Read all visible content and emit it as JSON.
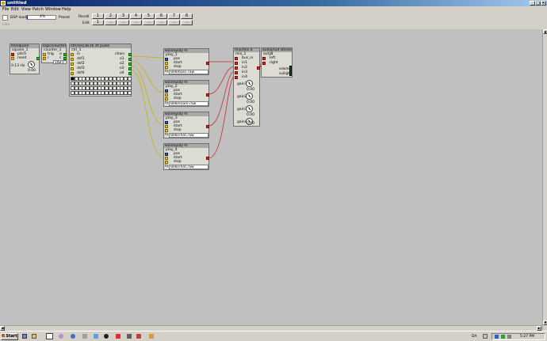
{
  "window": {
    "title": "untitled"
  },
  "menu": [
    "File",
    "Edit",
    "View",
    "Patch",
    "Window",
    "Help"
  ],
  "toolbar": {
    "dsp_label": "DSP load",
    "dsp_value": "4%",
    "dsp_fraction": 0.04,
    "preset_label": "Preset",
    "recall_label": "Recall",
    "edit_label": "Edit",
    "preset_numbers": [
      "1",
      "2",
      "3",
      "4",
      "5",
      "6",
      "7",
      "8"
    ],
    "preset_edit": [
      "1",
      "...",
      "...",
      "...",
      "...",
      "...",
      "...",
      "..."
    ],
    "live_label": "Live"
  },
  "objects": {
    "square": {
      "header": "lfo/square",
      "name": "square_1",
      "pitch": "pitch",
      "reset": "reset",
      "freq": "0.13 Hz",
      "value": "0.00"
    },
    "counter": {
      "header": "logic/counter",
      "name": "counter_1",
      "trig": "trig",
      "r": "r",
      "o": "o",
      "c": "c",
      "val1": "16",
      "val2": "0"
    },
    "seq": {
      "header": "ctrl/seq 8x16 4t pulse",
      "name": "ctrl_1",
      "in": "in",
      "dsf1": "dsf1",
      "dsf2": "dsf2",
      "dsf3": "dsf3",
      "dsf4": "dsf4",
      "chain": "chain",
      "o1": "o1",
      "o2": "o2",
      "o3": "o3",
      "o4": "o4"
    },
    "play1": {
      "header": "wave/play fn",
      "name": "play_1",
      "pos": "pos",
      "start": "start",
      "stop": "stop",
      "file": "808/bass.raw"
    },
    "play2": {
      "header": "wave/play fn",
      "name": "play_2",
      "pos": "pos",
      "start": "start",
      "stop": "stop",
      "file": "808/snare.raw"
    },
    "play3": {
      "header": "wave/play fn",
      "name": "play_3",
      "pos": "pos",
      "start": "start",
      "stop": "stop",
      "file": "808/chat.raw"
    },
    "play4": {
      "header": "wave/play fn",
      "name": "play_4",
      "pos": "pos",
      "start": "start",
      "stop": "stop",
      "file": "808/chat.raw"
    },
    "mix": {
      "header": "mix/mix 4",
      "name": "mix_1",
      "bus_in": "bus_in",
      "in1": "in1",
      "in2": "in2",
      "in3": "in3",
      "in4": "in4",
      "gain1": "gain1",
      "gain2": "gain2",
      "gain3": "gain3",
      "gain4": "gain4",
      "gain_values": [
        "0.00",
        "0.00",
        "0.00",
        "0.00"
      ]
    },
    "out": {
      "header": "audio/out stereo",
      "name": "out_1",
      "left": "left",
      "right": "right",
      "in": "in",
      "volume": "volume",
      "vu": "vu/light"
    }
  },
  "taskbar": {
    "start": "Start",
    "lang": "DA",
    "time": "5:27 PM"
  }
}
